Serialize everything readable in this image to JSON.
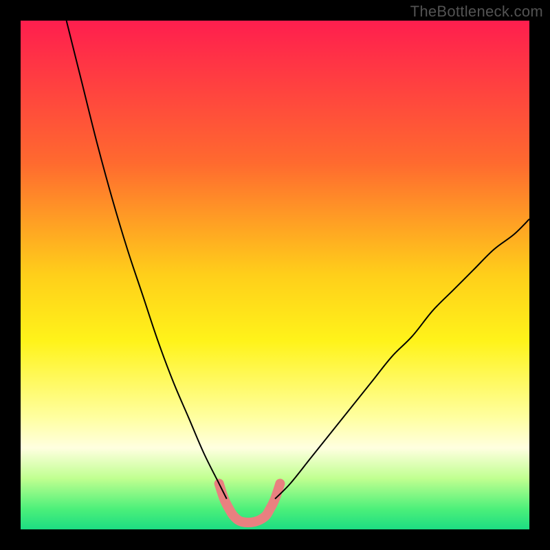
{
  "watermark": "TheBottleneck.com",
  "chart_data": {
    "type": "line",
    "title": "",
    "xlabel": "",
    "ylabel": "",
    "xlim": [
      0,
      100
    ],
    "ylim": [
      0,
      100
    ],
    "legend": false,
    "grid": false,
    "background_gradient": {
      "stops": [
        {
          "pos": 0.0,
          "color": "#ff1e4e"
        },
        {
          "pos": 0.28,
          "color": "#ff6a2f"
        },
        {
          "pos": 0.5,
          "color": "#ffcf1a"
        },
        {
          "pos": 0.63,
          "color": "#fff31a"
        },
        {
          "pos": 0.78,
          "color": "#ffffa0"
        },
        {
          "pos": 0.84,
          "color": "#ffffe0"
        },
        {
          "pos": 0.9,
          "color": "#c0ff90"
        },
        {
          "pos": 0.96,
          "color": "#4cf07a"
        },
        {
          "pos": 1.0,
          "color": "#1cdc82"
        }
      ]
    },
    "series": [
      {
        "name": "left-limb",
        "stroke": "#000000",
        "stroke_width": 2,
        "x": [
          9,
          12,
          15,
          18,
          21,
          24,
          27,
          30,
          33,
          36,
          39,
          40.5
        ],
        "y": [
          100,
          88,
          76,
          65,
          55,
          46,
          37,
          29,
          22,
          15,
          9,
          6
        ]
      },
      {
        "name": "right-limb",
        "stroke": "#000000",
        "stroke_width": 2,
        "x": [
          50,
          53,
          57,
          61,
          65,
          69,
          73,
          77,
          81,
          85,
          89,
          93,
          97,
          100
        ],
        "y": [
          6,
          9,
          14,
          19,
          24,
          29,
          34,
          38,
          43,
          47,
          51,
          55,
          58,
          61
        ]
      },
      {
        "name": "bottom-bridge-pink",
        "stroke": "#e98080",
        "stroke_width": 14,
        "linecap": "round",
        "x": [
          39,
          40,
          41,
          42,
          43.5,
          46,
          48,
          49,
          50,
          51
        ],
        "y": [
          9,
          6,
          4,
          2.5,
          1.5,
          1.5,
          2.5,
          4,
          6,
          9
        ]
      }
    ]
  }
}
